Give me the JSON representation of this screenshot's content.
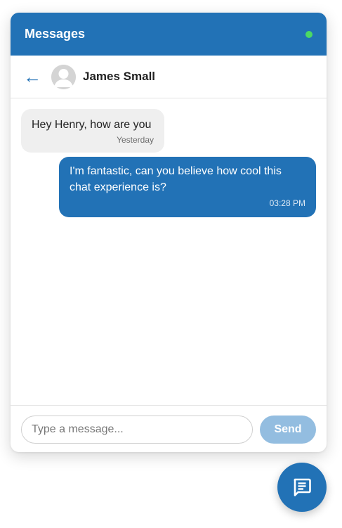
{
  "header": {
    "title": "Messages",
    "status_color": "#4cd964",
    "accent_color": "#2272b6"
  },
  "contact": {
    "name": "James Small",
    "back_icon": "back-arrow-icon",
    "avatar_icon": "default-avatar-icon"
  },
  "messages": [
    {
      "direction": "received",
      "text": "Hey Henry, how are you",
      "time": "Yesterday"
    },
    {
      "direction": "sent",
      "text": "I'm fantastic, can you believe how cool this chat experience is?",
      "time": "03:28 PM"
    }
  ],
  "composer": {
    "placeholder": "Type a message...",
    "value": "",
    "send_label": "Send"
  },
  "fab": {
    "icon": "chat-icon"
  }
}
